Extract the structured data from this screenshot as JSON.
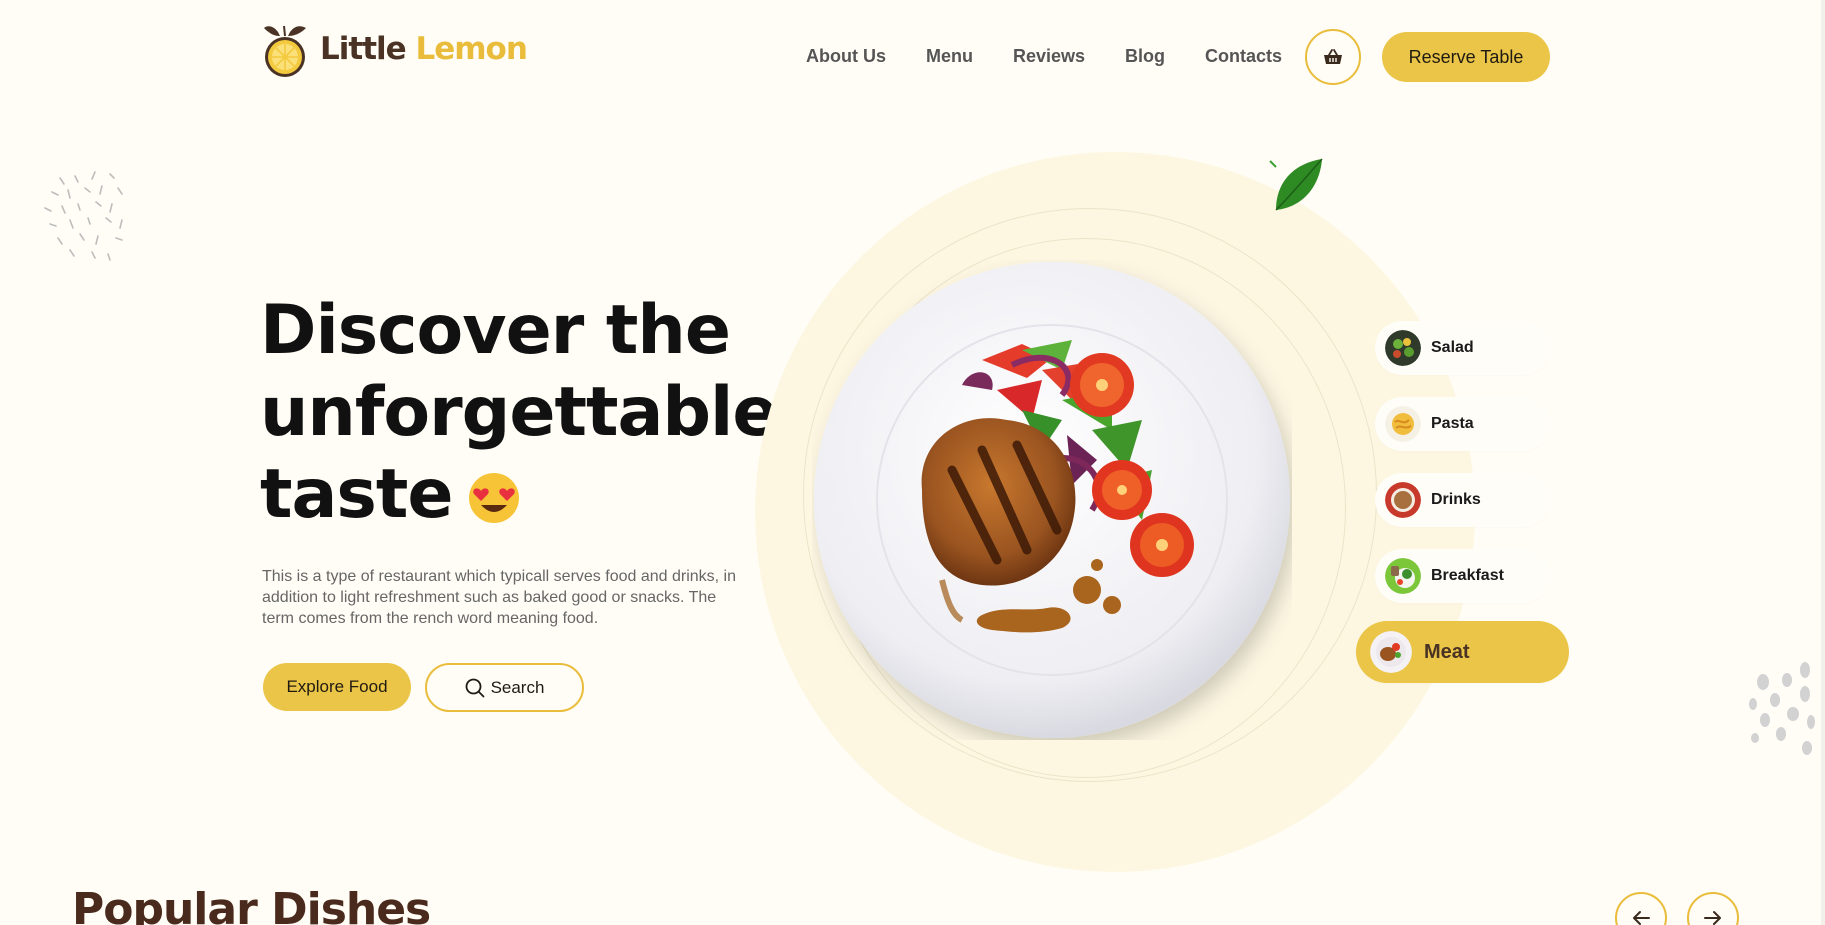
{
  "header": {
    "logo": {
      "word1": "Little",
      "word2": "Lemon"
    },
    "nav": [
      "About Us",
      "Menu",
      "Reviews",
      "Blog",
      "Contacts"
    ],
    "cart_icon": "basket-icon",
    "reserve_label": "Reserve Table"
  },
  "hero": {
    "title_lines": [
      "Discover the",
      "unforgettable",
      "taste"
    ],
    "title_emoji": "heart-eyes-emoji",
    "description": "This is a type of restaurant which typicall serves food and drinks, in addition to light refreshment such as baked good or snacks. The term comes from the rench word meaning food.",
    "explore_label": "Explore Food",
    "search_label": "Search"
  },
  "categories": [
    {
      "label": "Salad",
      "active": false
    },
    {
      "label": "Pasta",
      "active": false
    },
    {
      "label": "Drinks",
      "active": false
    },
    {
      "label": "Breakfast",
      "active": false
    },
    {
      "label": "Meat",
      "active": true
    }
  ],
  "popular": {
    "title": "Popular Dishes"
  },
  "colors": {
    "accent": "#ebc547",
    "brown": "#4a3324",
    "background": "#fffdf6"
  }
}
